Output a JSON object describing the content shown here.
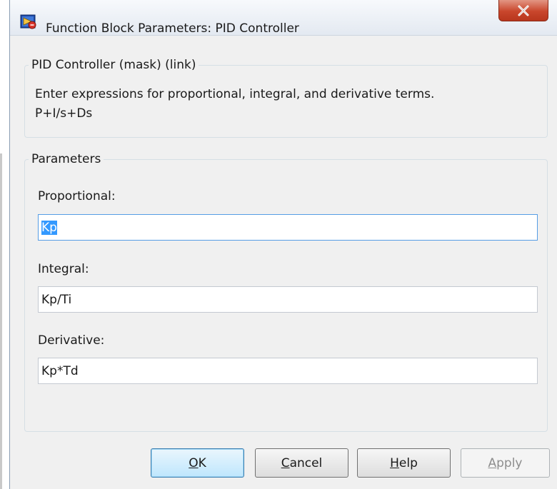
{
  "window": {
    "title": "Function Block Parameters: PID Controller"
  },
  "header_group": {
    "title": "PID Controller (mask) (link)",
    "description_line1": "Enter expressions for proportional, integral, and derivative terms.",
    "description_line2": "P+I/s+Ds"
  },
  "parameters_group": {
    "title": "Parameters",
    "fields": [
      {
        "label": "Proportional:",
        "value": "Kp",
        "selected": true
      },
      {
        "label": "Integral:",
        "value": "Kp/Ti",
        "selected": false
      },
      {
        "label": "Derivative:",
        "value": "Kp*Td",
        "selected": false
      }
    ]
  },
  "buttons": {
    "ok": {
      "mnemonic": "O",
      "rest": "K"
    },
    "cancel": {
      "mnemonic": "C",
      "rest": "ancel"
    },
    "help": {
      "mnemonic": "H",
      "rest": "elp"
    },
    "apply": {
      "mnemonic": "A",
      "rest": "pply",
      "enabled": false
    }
  },
  "icons": {
    "app": "simulink-block-icon",
    "close": "close-icon"
  },
  "colors": {
    "selection": "#3399ff",
    "close_button": "#c9462c",
    "focus_border": "#569de5"
  }
}
